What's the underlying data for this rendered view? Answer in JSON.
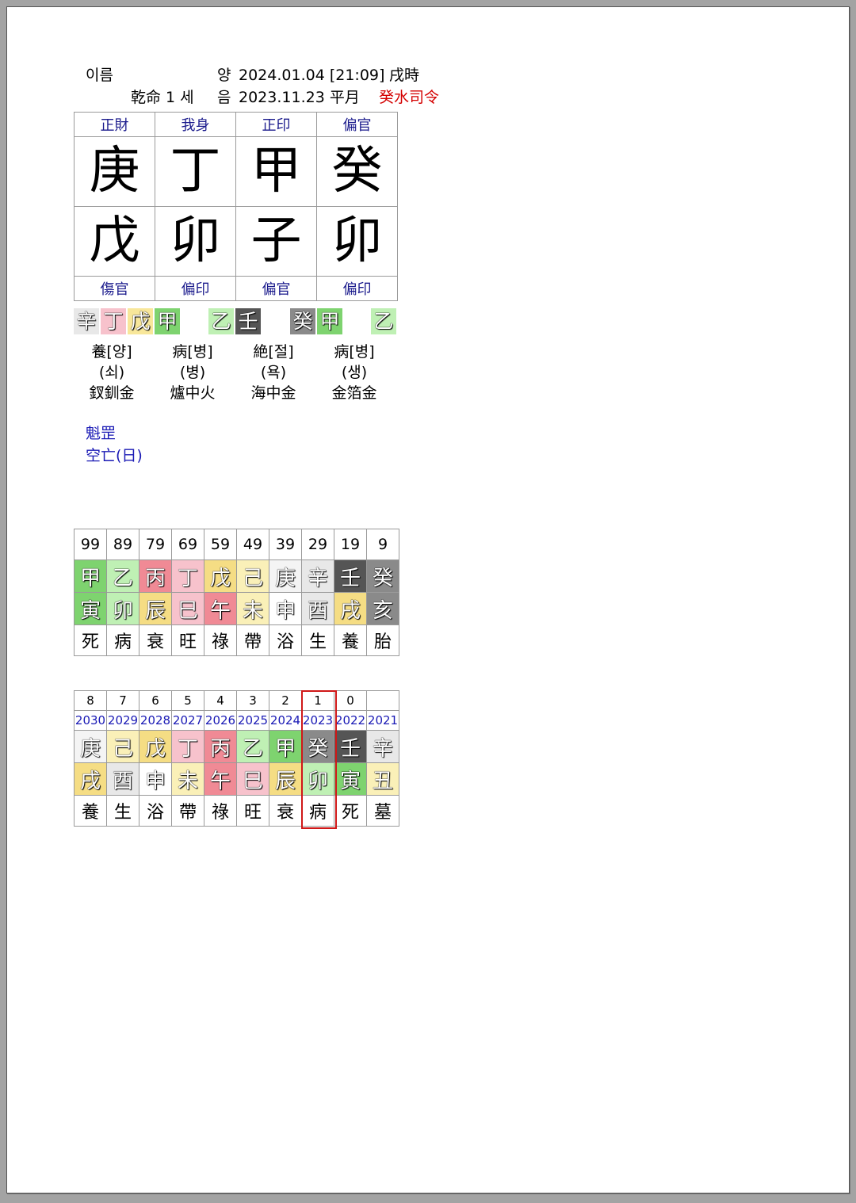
{
  "header": {
    "name_label": "이름",
    "gender_age": "乾命 1 세",
    "solar_label": "양",
    "solar_date": "2024.01.04 [21:09]",
    "solar_hour": "戌時",
    "lunar_label": "음",
    "lunar_date": "2023.11.23 平月",
    "commander": "癸水司令"
  },
  "pillars": {
    "top_labels": [
      "正財",
      "我身",
      "正印",
      "偏官"
    ],
    "stems": [
      "庚",
      "丁",
      "甲",
      "癸"
    ],
    "branches": [
      "戊",
      "卯",
      "子",
      "卯"
    ],
    "bottom_labels": [
      "傷官",
      "偏印",
      "偏官",
      "偏印"
    ]
  },
  "hidden_stems": [
    {
      "char": "辛",
      "color": "#e8e8e8"
    },
    {
      "char": "丁",
      "color": "#f7c2cc"
    },
    {
      "char": "戊",
      "color": "#f8e79a"
    },
    {
      "char": "甲",
      "color": "#7ed36f"
    },
    {
      "char": "乙",
      "color": "#bff0b4"
    },
    {
      "char": "壬",
      "color": "#555555"
    },
    {
      "char": "癸",
      "color": "#8a8a8a"
    },
    {
      "char": "甲",
      "color": "#7ed36f"
    },
    {
      "char": "乙",
      "color": "#bff0b4"
    }
  ],
  "stages": [
    {
      "stage": "養[양]",
      "sub": "(쇠)",
      "nayin": "釵釧金"
    },
    {
      "stage": "病[병]",
      "sub": "(병)",
      "nayin": "爐中火"
    },
    {
      "stage": "絶[절]",
      "sub": "(욕)",
      "nayin": "海中金"
    },
    {
      "stage": "病[병]",
      "sub": "(생)",
      "nayin": "金箔金"
    }
  ],
  "spirits": [
    "魁罡",
    "空亡(日)"
  ],
  "daeun": {
    "ages": [
      "99",
      "89",
      "79",
      "69",
      "59",
      "49",
      "39",
      "29",
      "19",
      "9"
    ],
    "stems": [
      "甲",
      "乙",
      "丙",
      "丁",
      "戊",
      "己",
      "庚",
      "辛",
      "壬",
      "癸"
    ],
    "stem_colors": [
      "#7ed36f",
      "#bff0b4",
      "#f08a95",
      "#f7c2cc",
      "#f5dd84",
      "#faf0b8",
      "#f4f4f4",
      "#e8e8e8",
      "#555555",
      "#8a8a8a"
    ],
    "branches": [
      "寅",
      "卯",
      "辰",
      "巳",
      "午",
      "未",
      "申",
      "酉",
      "戌",
      "亥"
    ],
    "branch_colors": [
      "#7ed36f",
      "#bff0b4",
      "#f5dd84",
      "#f7c2cc",
      "#f08a95",
      "#faf0b8",
      "#ffffff",
      "#e8e8e8",
      "#f5dd84",
      "#8a8a8a"
    ],
    "stages": [
      "死",
      "病",
      "衰",
      "旺",
      "祿",
      "帶",
      "浴",
      "生",
      "養",
      "胎"
    ]
  },
  "seun": {
    "ages": [
      "8",
      "7",
      "6",
      "5",
      "4",
      "3",
      "2",
      "1",
      "0",
      ""
    ],
    "years": [
      "2030",
      "2029",
      "2028",
      "2027",
      "2026",
      "2025",
      "2024",
      "2023",
      "2022",
      "2021"
    ],
    "stems": [
      "庚",
      "己",
      "戊",
      "丁",
      "丙",
      "乙",
      "甲",
      "癸",
      "壬",
      "辛"
    ],
    "stem_colors": [
      "#f4f4f4",
      "#faf0b8",
      "#f5dd84",
      "#f7c2cc",
      "#f08a95",
      "#bff0b4",
      "#7ed36f",
      "#8a8a8a",
      "#555555",
      "#e8e8e8"
    ],
    "branches": [
      "戌",
      "酉",
      "申",
      "未",
      "午",
      "巳",
      "辰",
      "卯",
      "寅",
      "丑"
    ],
    "branch_colors": [
      "#f5dd84",
      "#e8e8e8",
      "#ffffff",
      "#faf0b8",
      "#f08a95",
      "#f7c2cc",
      "#f5dd84",
      "#bff0b4",
      "#7ed36f",
      "#faf0b8"
    ],
    "stages": [
      "養",
      "生",
      "浴",
      "帶",
      "祿",
      "旺",
      "衰",
      "病",
      "死",
      "墓"
    ],
    "highlight_index": 7
  }
}
